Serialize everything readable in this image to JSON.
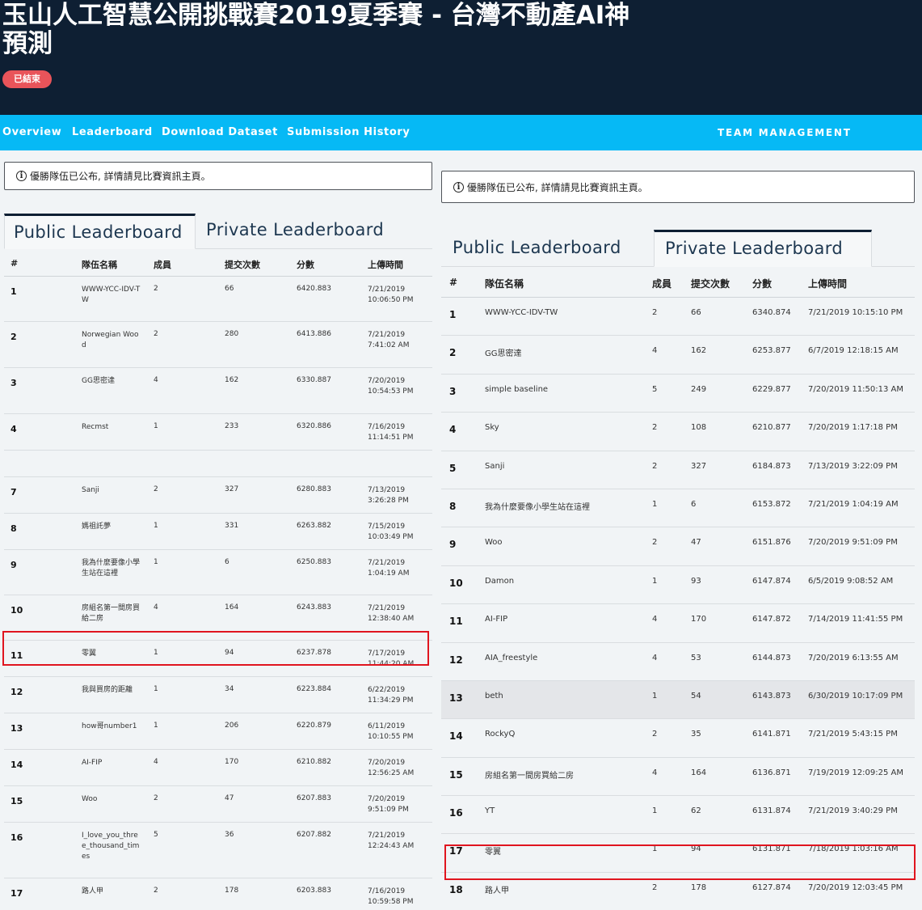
{
  "header": {
    "title": "玉山人工智慧公開挑戰賽2019夏季賽 - 台灣不動產AI神預測",
    "status_badge": "已結束"
  },
  "nav": {
    "items": [
      "Overview",
      "Leaderboard",
      "Download Dataset",
      "Submission History"
    ],
    "team_management": "TEAM MANAGEMENT"
  },
  "notice": {
    "icon": "info-icon",
    "text": "優勝隊伍已公布, 詳情請見比賽資訊主頁。"
  },
  "tabs": {
    "public": "Public Leaderboard",
    "private": "Private Leaderboard"
  },
  "columns": {
    "rank": "#",
    "team": "隊伍名稱",
    "members": "成員",
    "submissions": "提交次數",
    "score": "分數",
    "uploaded": "上傳時間"
  },
  "public_rows": [
    {
      "rank": "1",
      "team": "WWW-YCC-IDV-TW",
      "members": "2",
      "submissions": "66",
      "score": "6420.883",
      "uploaded": "7/21/2019 10:06:50 PM"
    },
    {
      "rank": "2",
      "team": "Norwegian Wood",
      "members": "2",
      "submissions": "280",
      "score": "6413.886",
      "uploaded": "7/21/2019 7:41:02 AM"
    },
    {
      "rank": "3",
      "team": "GG思密達",
      "members": "4",
      "submissions": "162",
      "score": "6330.887",
      "uploaded": "7/20/2019 10:54:53 PM"
    },
    {
      "rank": "4",
      "team": "Recmst",
      "members": "1",
      "submissions": "233",
      "score": "6320.886",
      "uploaded": "7/16/2019 11:14:51 PM"
    },
    {
      "rank": "",
      "team": "",
      "members": "",
      "submissions": "",
      "score": "",
      "uploaded": ""
    },
    {
      "rank": "7",
      "team": "Sanji",
      "members": "2",
      "submissions": "327",
      "score": "6280.883",
      "uploaded": "7/13/2019 3:26:28 PM"
    },
    {
      "rank": "8",
      "team": "媽祖託夢",
      "members": "1",
      "submissions": "331",
      "score": "6263.882",
      "uploaded": "7/15/2019 10:03:49 PM"
    },
    {
      "rank": "9",
      "team": "我為什麼要像小學生站在這裡",
      "members": "1",
      "submissions": "6",
      "score": "6250.883",
      "uploaded": "7/21/2019 1:04:19 AM"
    },
    {
      "rank": "10",
      "team": "房組名第一間房買給二房",
      "members": "4",
      "submissions": "164",
      "score": "6243.883",
      "uploaded": "7/21/2019 12:38:40 AM"
    },
    {
      "rank": "11",
      "team": "零翼",
      "members": "1",
      "submissions": "94",
      "score": "6237.878",
      "uploaded": "7/17/2019 11:44:20 AM"
    },
    {
      "rank": "12",
      "team": "我與買房的距離",
      "members": "1",
      "submissions": "34",
      "score": "6223.884",
      "uploaded": "6/22/2019 11:34:29 PM"
    },
    {
      "rank": "13",
      "team": "how哥number1",
      "members": "1",
      "submissions": "206",
      "score": "6220.879",
      "uploaded": "6/11/2019 10:10:55 PM"
    },
    {
      "rank": "14",
      "team": "AI-FIP",
      "members": "4",
      "submissions": "170",
      "score": "6210.882",
      "uploaded": "7/20/2019 12:56:25 AM"
    },
    {
      "rank": "15",
      "team": "Woo",
      "members": "2",
      "submissions": "47",
      "score": "6207.883",
      "uploaded": "7/20/2019 9:51:09 PM"
    },
    {
      "rank": "16",
      "team": "I_love_you_three_thousand_times",
      "members": "5",
      "submissions": "36",
      "score": "6207.882",
      "uploaded": "7/21/2019 12:24:43 AM"
    },
    {
      "rank": "17",
      "team": "路人甲",
      "members": "2",
      "submissions": "178",
      "score": "6203.883",
      "uploaded": "7/16/2019 10:59:58 PM"
    }
  ],
  "private_rows": [
    {
      "rank": "1",
      "team": "WWW-YCC-IDV-TW",
      "members": "2",
      "submissions": "66",
      "score": "6340.874",
      "uploaded": "7/21/2019 10:15:10 PM"
    },
    {
      "rank": "2",
      "team": "GG思密達",
      "members": "4",
      "submissions": "162",
      "score": "6253.877",
      "uploaded": "6/7/2019 12:18:15 AM"
    },
    {
      "rank": "3",
      "team": "simple baseline",
      "members": "5",
      "submissions": "249",
      "score": "6229.877",
      "uploaded": "7/20/2019 11:50:13 AM"
    },
    {
      "rank": "4",
      "team": "Sky",
      "members": "2",
      "submissions": "108",
      "score": "6210.877",
      "uploaded": "7/20/2019 1:17:18 PM"
    },
    {
      "rank": "5",
      "team": "Sanji",
      "members": "2",
      "submissions": "327",
      "score": "6184.873",
      "uploaded": "7/13/2019 3:22:09 PM"
    },
    {
      "rank": "8",
      "team": "我為什麼要像小學生站在這裡",
      "members": "1",
      "submissions": "6",
      "score": "6153.872",
      "uploaded": "7/21/2019 1:04:19 AM"
    },
    {
      "rank": "9",
      "team": "Woo",
      "members": "2",
      "submissions": "47",
      "score": "6151.876",
      "uploaded": "7/20/2019 9:51:09 PM"
    },
    {
      "rank": "10",
      "team": "Damon",
      "members": "1",
      "submissions": "93",
      "score": "6147.874",
      "uploaded": "6/5/2019 9:08:52 AM"
    },
    {
      "rank": "11",
      "team": "AI-FIP",
      "members": "4",
      "submissions": "170",
      "score": "6147.872",
      "uploaded": "7/14/2019 11:41:55 PM"
    },
    {
      "rank": "12",
      "team": "AIA_freestyle",
      "members": "4",
      "submissions": "53",
      "score": "6144.873",
      "uploaded": "7/20/2019 6:13:55 AM"
    },
    {
      "rank": "13",
      "team": "beth",
      "members": "1",
      "submissions": "54",
      "score": "6143.873",
      "uploaded": "6/30/2019 10:17:09 PM"
    },
    {
      "rank": "14",
      "team": "RockyQ",
      "members": "2",
      "submissions": "35",
      "score": "6141.871",
      "uploaded": "7/21/2019 5:43:15 PM"
    },
    {
      "rank": "15",
      "team": "房組名第一間房買給二房",
      "members": "4",
      "submissions": "164",
      "score": "6136.871",
      "uploaded": "7/19/2019 12:09:25 AM"
    },
    {
      "rank": "16",
      "team": "YT",
      "members": "1",
      "submissions": "62",
      "score": "6131.874",
      "uploaded": "7/21/2019 3:40:29 PM"
    },
    {
      "rank": "17",
      "team": "零翼",
      "members": "1",
      "submissions": "94",
      "score": "6131.871",
      "uploaded": "7/18/2019 1:03:16 AM"
    },
    {
      "rank": "18",
      "team": "路人甲",
      "members": "2",
      "submissions": "178",
      "score": "6127.874",
      "uploaded": "7/20/2019 12:03:45 PM"
    }
  ],
  "highlight_color": "#e0151f"
}
